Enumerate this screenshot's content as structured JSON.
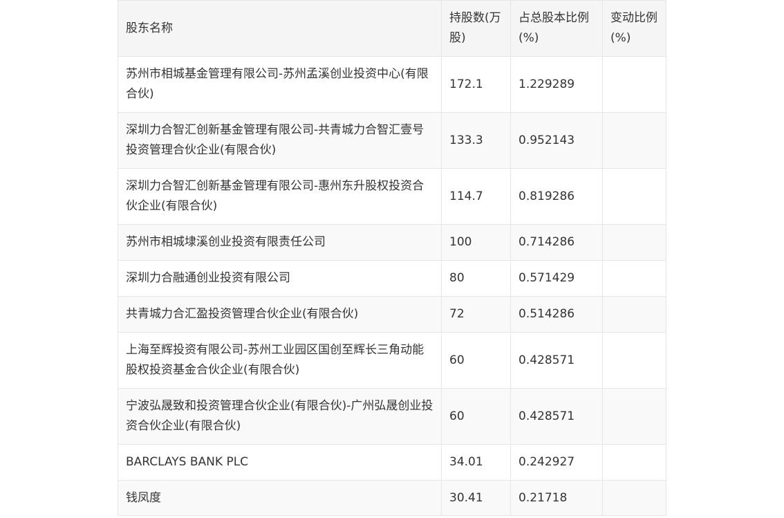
{
  "table": {
    "headers": {
      "name": "股东名称",
      "shares": "持股数(万股)",
      "ratio": "占总股本比例(%)",
      "change": "变动比例(%)"
    },
    "rows": [
      {
        "name": "苏州市相城基金管理有限公司-苏州孟溪创业投资中心(有限合伙)",
        "shares": "172.1",
        "ratio": "1.229289",
        "change": ""
      },
      {
        "name": "深圳力合智汇创新基金管理有限公司-共青城力合智汇壹号投资管理合伙企业(有限合伙)",
        "shares": "133.3",
        "ratio": "0.952143",
        "change": ""
      },
      {
        "name": "深圳力合智汇创新基金管理有限公司-惠州东升股权投资合伙企业(有限合伙)",
        "shares": "114.7",
        "ratio": "0.819286",
        "change": ""
      },
      {
        "name": "苏州市相城埭溪创业投资有限责任公司",
        "shares": "100",
        "ratio": "0.714286",
        "change": ""
      },
      {
        "name": "深圳力合融通创业投资有限公司",
        "shares": "80",
        "ratio": "0.571429",
        "change": ""
      },
      {
        "name": "共青城力合汇盈投资管理合伙企业(有限合伙)",
        "shares": "72",
        "ratio": "0.514286",
        "change": ""
      },
      {
        "name": "上海至辉投资有限公司-苏州工业园区国创至辉长三角动能股权投资基金合伙企业(有限合伙)",
        "shares": "60",
        "ratio": "0.428571",
        "change": ""
      },
      {
        "name": "宁波弘晟致和投资管理合伙企业(有限合伙)-广州弘晟创业投资合伙企业(有限合伙)",
        "shares": "60",
        "ratio": "0.428571",
        "change": ""
      },
      {
        "name": "BARCLAYS BANK PLC",
        "shares": "34.01",
        "ratio": "0.242927",
        "change": ""
      },
      {
        "name": "钱凤度",
        "shares": "30.41",
        "ratio": "0.21718",
        "change": ""
      }
    ]
  }
}
